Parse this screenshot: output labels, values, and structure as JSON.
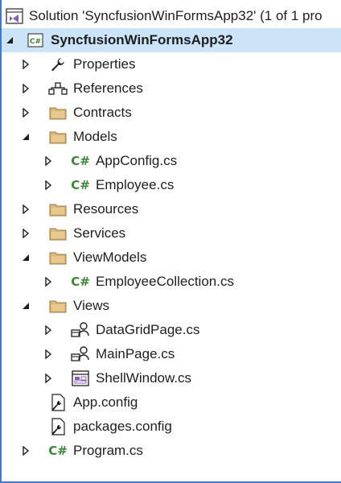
{
  "solution": {
    "title": "Solution 'SyncfusionWinFormsApp32' (1 of 1 pro",
    "icon": "visual-studio-solution-icon"
  },
  "project": {
    "name": "SyncfusionWinFormsApp32",
    "icon": "csharp-project-icon",
    "expanded": true,
    "selected": true
  },
  "items": {
    "properties": "Properties",
    "references": "References",
    "contracts": "Contracts",
    "models": "Models",
    "appconfig_cs": "AppConfig.cs",
    "employee_cs": "Employee.cs",
    "resources": "Resources",
    "services": "Services",
    "viewmodels": "ViewModels",
    "employeecollection_cs": "EmployeeCollection.cs",
    "views": "Views",
    "datagridpage_cs": "DataGridPage.cs",
    "mainpage_cs": "MainPage.cs",
    "shellwindow_cs": "ShellWindow.cs",
    "app_config": "App.config",
    "packages_config": "packages.config",
    "program_cs": "Program.cs"
  },
  "icons": {
    "csharp_label": "C#",
    "folder_color": "#dcb67a",
    "csharp_color": "#388a34",
    "selection_color": "#cce4f7",
    "border_color": "#3a7bd5"
  }
}
